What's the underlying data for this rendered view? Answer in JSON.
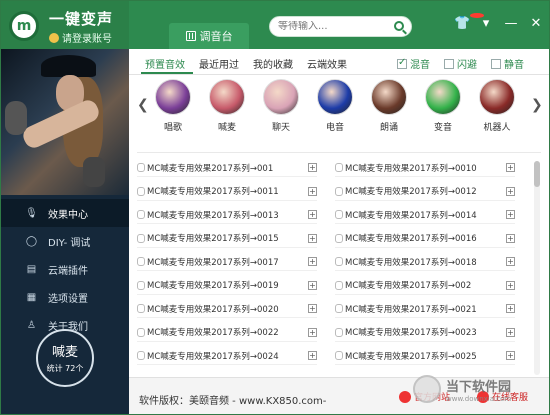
{
  "app": {
    "title": "一键变声",
    "login_label": "请登录账号",
    "logo_text": "m"
  },
  "header": {
    "tab_label": "调音台",
    "search_placeholder": "等待输入...",
    "search_value": ""
  },
  "window_buttons": [
    "shirt-icon",
    "menu-icon",
    "minimize-icon",
    "close-icon"
  ],
  "sidebar": {
    "items": [
      {
        "icon": "mic-icon",
        "label": "效果中心"
      },
      {
        "icon": "diy-icon",
        "label": "DIY- 调试"
      },
      {
        "icon": "doc-icon",
        "label": "云端插件"
      },
      {
        "icon": "settings-icon",
        "label": "选项设置"
      },
      {
        "icon": "user-icon",
        "label": "关于我们"
      }
    ],
    "active_index": 0,
    "stat": {
      "title": "喊麦",
      "count": "统计 72个"
    }
  },
  "tabs": [
    "预置音效",
    "最近用过",
    "我的收藏",
    "云端效果"
  ],
  "active_tab": 0,
  "checks": [
    {
      "label": "混音",
      "checked": true
    },
    {
      "label": "闪避",
      "checked": false
    },
    {
      "label": "静音",
      "checked": false
    }
  ],
  "effects": [
    {
      "label": "唱歌",
      "color": "#7b3f98"
    },
    {
      "label": "喊麦",
      "color": "#c75a6a"
    },
    {
      "label": "聊天",
      "color": "#d9a3b6"
    },
    {
      "label": "电音",
      "color": "#1d3ca8"
    },
    {
      "label": "朗诵",
      "color": "#6a3a2a"
    },
    {
      "label": "变音",
      "color": "#33b24a"
    },
    {
      "label": "机器人",
      "color": "#8a2a28"
    }
  ],
  "list_left": [
    "MC喊麦专用效果2017系列→001",
    "MC喊麦专用效果2017系列→0011",
    "MC喊麦专用效果2017系列→0013",
    "MC喊麦专用效果2017系列→0015",
    "MC喊麦专用效果2017系列→0017",
    "MC喊麦专用效果2017系列→0019",
    "MC喊麦专用效果2017系列→0020",
    "MC喊麦专用效果2017系列→0022",
    "MC喊麦专用效果2017系列→0024"
  ],
  "list_right": [
    "MC喊麦专用效果2017系列→0010",
    "MC喊麦专用效果2017系列→0012",
    "MC喊麦专用效果2017系列→0014",
    "MC喊麦专用效果2017系列→0016",
    "MC喊麦专用效果2017系列→0018",
    "MC喊麦专用效果2017系列→002",
    "MC喊麦专用效果2017系列→0021",
    "MC喊麦专用效果2017系列→0023",
    "MC喊麦专用效果2017系列→0025"
  ],
  "footer": {
    "copyright": "软件版权：美颐音频 - www.KX850.com-",
    "site_label": "官方网站",
    "service_label": "在线客服"
  },
  "watermark": {
    "title": "当下软件园",
    "subtitle": "www.downxia.com"
  }
}
